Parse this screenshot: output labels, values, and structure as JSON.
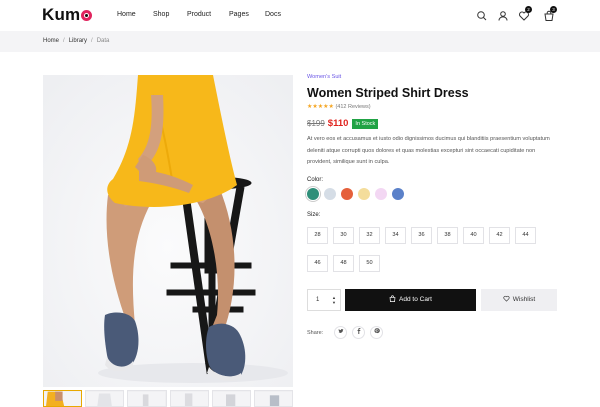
{
  "header": {
    "logo_text": "Kum",
    "nav": [
      "Home",
      "Shop",
      "Product",
      "Pages",
      "Docs"
    ],
    "wishlist_count": "2",
    "cart_count": "3"
  },
  "breadcrumb": [
    "Home",
    "Library",
    "Data"
  ],
  "product": {
    "category": "Women's Suit",
    "title": "Women Striped Shirt Dress",
    "stars": "★★★★★",
    "reviews": "(412 Reviews)",
    "old_price": "$199",
    "price": "$110",
    "stock": "In Stock",
    "description": "At vero eos et accusamus et iusto odio dignissimos ducimus qui blanditiis praesentium voluptatum deleniti atque corrupti quos dolores et quas molestias excepturi sint occaecati cupiditate non provident, similique sunt in culpa.",
    "color_label": "Color:",
    "colors": [
      "#2f8f79",
      "#d5dde6",
      "#e5603b",
      "#f4dd9b",
      "#f3d7f3",
      "#5b81c9"
    ],
    "size_label": "Size:",
    "sizes": [
      "28",
      "30",
      "32",
      "34",
      "36",
      "38",
      "40",
      "42",
      "44",
      "46",
      "48",
      "50"
    ],
    "quantity": "1",
    "add_to_cart": "Add to Cart",
    "wishlist": "Wishlist",
    "share_label": "Share:",
    "share_icons": [
      "twitter-icon",
      "facebook-icon",
      "pinterest-icon"
    ]
  }
}
